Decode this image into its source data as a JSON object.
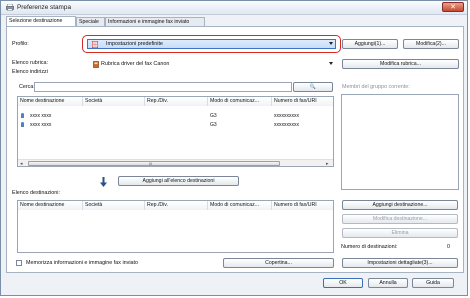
{
  "window": {
    "title": "Preferenze stampa",
    "close_glyph": "✕"
  },
  "tabs": [
    {
      "label": "Selezione destinazione",
      "active": true
    },
    {
      "label": "Speciale",
      "active": false
    },
    {
      "label": "Informazioni e immagine fax inviato",
      "active": false
    }
  ],
  "profile": {
    "label": "Profilo:",
    "value": "Impostazioni predefinite",
    "add_button": "Aggiungi(1)...",
    "edit_button": "Modifica(2)..."
  },
  "addressbook": {
    "label": "Elenco rubrica:",
    "value": "Rubrica driver del fax Canon",
    "edit_button": "Modifica rubrica..."
  },
  "address_list": {
    "label": "Elenco indirizzi",
    "search_label": "Cerca:",
    "search_value": "",
    "search_icon": "🔍"
  },
  "columns": [
    "Nome destinazione",
    "Società",
    "Rep./Div.",
    "Modo di comunicaz...",
    "Numero di fax/URI"
  ],
  "address_rows": [
    {
      "name": "xxxx xxxx",
      "mode": "G3",
      "number": "xxxxxxxxxx"
    },
    {
      "name": "xxxx xxxx",
      "mode": "G3",
      "number": "xxxxxxxxxx"
    }
  ],
  "scroll": {
    "left": "◂",
    "right": "▸",
    "grip": "III"
  },
  "group_members": {
    "label": "Membri del gruppo corrente:"
  },
  "add_to_list_button": "Aggiungi all'elenco destinazioni",
  "destination_list": {
    "label": "Elenco destinazioni:"
  },
  "dest_buttons": {
    "add": "Aggiungi destinazione...",
    "edit": "Modifica destinazione...",
    "delete": "Elimina"
  },
  "dest_count": {
    "label": "Numero di destinazioni:",
    "value": "0"
  },
  "remember": {
    "label": "Memorizza informazioni e immagine fax inviato",
    "checked": false
  },
  "cover_button": "Copertina...",
  "detail_button": "Impostazioni dettagliate(3)...",
  "footer": {
    "ok": "OK",
    "cancel": "Annulla",
    "help": "Guida"
  },
  "colors": {
    "accent": "#3f73c4",
    "highlight": "#d72a22"
  }
}
